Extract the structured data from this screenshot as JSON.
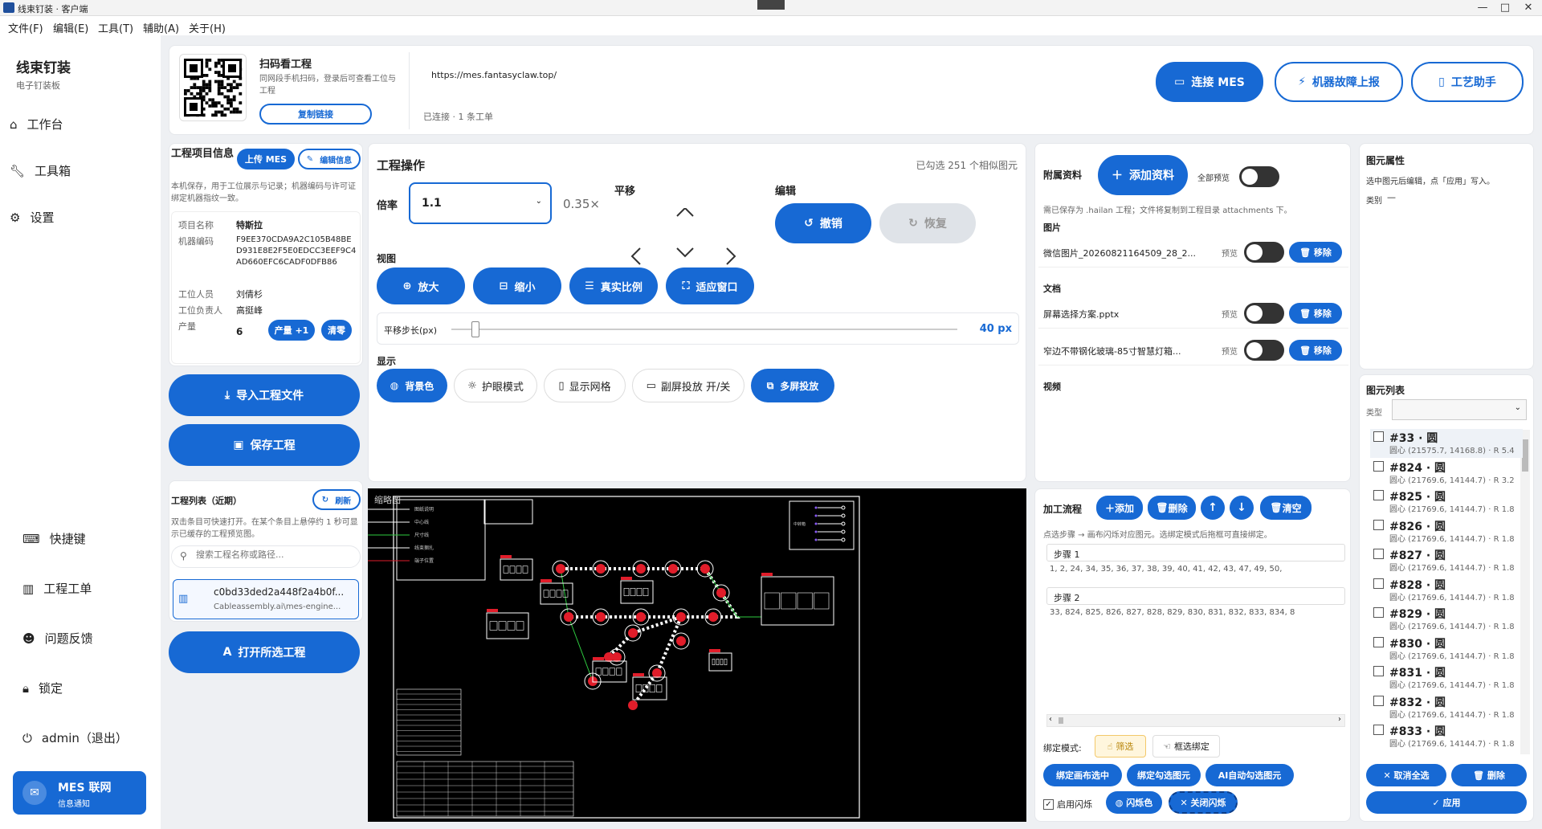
{
  "window": {
    "title": "线束钉装 · 客户端",
    "min": "—",
    "max": "□",
    "close": "✕"
  },
  "menu": [
    "文件(F)",
    "编辑(E)",
    "工具(T)",
    "辅助(A)",
    "关于(H)"
  ],
  "brand": {
    "title": "线束钉装",
    "subtitle": "电子钉装板"
  },
  "nav": {
    "workbench": "工作台",
    "toolbox": "工具箱",
    "settings": "设置",
    "shortcuts": "快捷键",
    "workorders": "工程工单",
    "feedback": "问题反馈",
    "lock": "锁定",
    "user": "admin（退出）"
  },
  "mes_notice": {
    "title": "MES 联网",
    "sub": "信息通知"
  },
  "scan": {
    "title": "扫码看工程",
    "desc": "同网段手机扫码，登录后可查看工位与工程",
    "copy": "复制链接",
    "url": "https://mes.fantasyclaw.top/",
    "status": "已连接 · 1 条工单"
  },
  "top_buttons": {
    "connect": "连接 MES",
    "report": "机器故障上报",
    "assist": "工艺助手"
  },
  "project_info": {
    "title": "工程项目信息",
    "upload": "上传 MES",
    "edit": "编辑信息",
    "desc": "本机保存，用于工位展示与记录；机器编码与许可证绑定机器指纹一致。",
    "name_label": "项目名称",
    "name": "特斯拉",
    "code_label": "机器编码",
    "code": "F9EE370CDA9A2C105B48BED931E8E2F5E0EDCC3EEF9C4AD660EFC6CADF0DFB86",
    "worker_label": "工位人员",
    "worker": "刘倩杉",
    "lead_label": "工位负责人",
    "lead": "高挺峰",
    "output_label": "产量",
    "output": "6",
    "plus": "产量 +1",
    "clear": "清零"
  },
  "actions": {
    "import": "导入工程文件",
    "save": "保存工程",
    "open": "打开所选工程"
  },
  "project_list": {
    "title": "工程列表（近期）",
    "refresh": "刷新",
    "desc": "双击条目可快速打开。在某个条目上悬停约 1 秒可显示已缓存的工程预览图。",
    "search_placeholder": "搜索工程名称或路径...",
    "item_title": "c0bd33ded2a448f2a4b0f...",
    "item_path": "Cableassembly.ai\\mes-engine..."
  },
  "ops": {
    "title": "工程操作",
    "selected": "已勾选 251 个相似图元",
    "zoom_label": "倍率",
    "zoom_value": "1.1",
    "scale": "0.35×",
    "pan": "平移",
    "edit": "编辑",
    "undo": "撤销",
    "redo": "恢复",
    "view": "视图",
    "zoom_in": "放大",
    "zoom_out": "缩小",
    "real": "真实比例",
    "fit": "适应窗口",
    "step_label": "平移步长(px)",
    "step_value": "40 px",
    "step_fraction": 0.04,
    "display": "显示",
    "bg": "背景色",
    "eye": "护眼模式",
    "grid": "显示网格",
    "second": "副屏投放 开/关",
    "multi": "多屏投放"
  },
  "attachments": {
    "title": "附属资料",
    "add": "添加资料",
    "preview_all": "全部预览",
    "desc": "需已保存为 .hailan 工程；文件将复制到工程目录 attachments 下。",
    "images": "图片",
    "docs": "文档",
    "video": "视频",
    "preview": "预览",
    "remove": "移除",
    "files": [
      "微信图片_20260821164509_28_2...",
      "屏幕选择方案.pptx",
      "窄边不带钢化玻璃-85寸智慧灯箱..."
    ]
  },
  "process": {
    "title": "加工流程",
    "add": "添加",
    "delete": "删除",
    "clear": "清空",
    "desc": "点选步骤 → 画布闪烁对应图元。选绑定模式后拖框可直接绑定。",
    "steps": [
      {
        "name": "步骤 1",
        "ids": "1, 2, 24, 34, 35, 36, 37, 38, 39, 40, 41, 42, 43, 47, 49, 50,"
      },
      {
        "name": "步骤 2",
        "ids": "33, 824, 825, 826, 827, 828, 829, 830, 831, 832, 833, 834, 8"
      }
    ],
    "bind_mode": "绑定模式:",
    "filter": "筛选",
    "box_bind": "框选绑定",
    "bind_canvas": "绑定画布选中",
    "bind_checked": "绑定勾选图元",
    "ai_select": "AI自动勾选图元",
    "flash_enable": "启用闪烁",
    "flash_color": "闪烁色",
    "close_flash": "关闭闪烁"
  },
  "props": {
    "title": "图元属性",
    "desc": "选中图元后编辑，点「应用」写入。",
    "type_label": "类别",
    "type_value": "—"
  },
  "elements": {
    "title": "图元列表",
    "type_label": "类型",
    "cancel_all": "取消全选",
    "delete": "删除",
    "apply": "应用",
    "items": [
      {
        "t": "#33 · 圆",
        "s": "圆心 (21575.7, 14168.8) · R 5.4"
      },
      {
        "t": "#824 · 圆",
        "s": "圆心 (21769.6, 14144.7) · R 3.2"
      },
      {
        "t": "#825 · 圆",
        "s": "圆心 (21769.6, 14144.7) · R 1.8"
      },
      {
        "t": "#826 · 圆",
        "s": "圆心 (21769.6, 14144.7) · R 1.8"
      },
      {
        "t": "#827 · 圆",
        "s": "圆心 (21769.6, 14144.7) · R 1.8"
      },
      {
        "t": "#828 · 圆",
        "s": "圆心 (21769.6, 14144.7) · R 1.8"
      },
      {
        "t": "#829 · 圆",
        "s": "圆心 (21769.6, 14144.7) · R 1.8"
      },
      {
        "t": "#830 · 圆",
        "s": "圆心 (21769.6, 14144.7) · R 1.8"
      },
      {
        "t": "#831 · 圆",
        "s": "圆心 (21769.6, 14144.7) · R 1.8"
      },
      {
        "t": "#832 · 圆",
        "s": "圆心 (21769.6, 14144.7) · R 1.8"
      },
      {
        "t": "#833 · 圆",
        "s": "圆心 (21769.6, 14144.7) · R 1.8"
      }
    ]
  },
  "canvas": {
    "thumb_label": "缩略图",
    "legend": [
      "图纸说明",
      "中心线",
      "尺寸线",
      "线束捆扎",
      "端子位置"
    ],
    "side_label": "中转箱"
  },
  "colors": {
    "accent": "#1769d4",
    "canvas_bg": "#000000",
    "wire": "#ffffff",
    "node": "#e11d2a"
  }
}
